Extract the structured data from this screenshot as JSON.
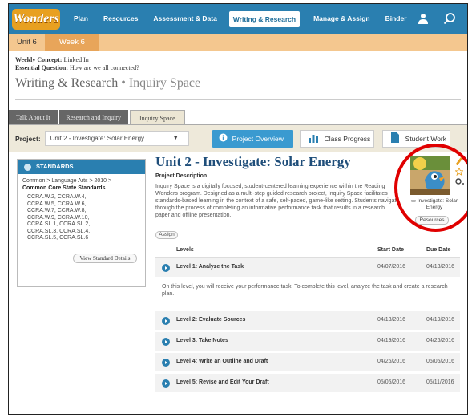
{
  "app": {
    "logo": "Wonders"
  },
  "nav": {
    "items": [
      "Plan",
      "Resources",
      "Assessment & Data",
      "Writing & Research",
      "Manage & Assign",
      "Binder"
    ],
    "active": "Writing & Research"
  },
  "unitbar": {
    "unit": "Unit 6",
    "week": "Week 6"
  },
  "concept": {
    "weekly_label": "Weekly Concept:",
    "weekly_value": "Linked In",
    "question_label": "Essential Question:",
    "question_value": "How are we all connected?"
  },
  "section": {
    "title": "Writing & Research",
    "separator": "•",
    "subtitle": "Inquiry Space"
  },
  "tabs": [
    "Talk About It",
    "Research and Inquiry",
    "Inquiry Space"
  ],
  "project": {
    "label": "Project:",
    "selected": "Unit 2 - Investigate: Solar Energy",
    "overview_button": "Project Overview",
    "progress_button": "Class Progress",
    "work_button": "Student Work"
  },
  "standards": {
    "header": "STANDARDS",
    "path": "Common > Language Arts > 2010 >",
    "set": "Common Core State Standards",
    "codes": [
      "CCRA.W.2, CCRA.W.4,",
      "CCRA.W.5, CCRA.W.6,",
      "CCRA.W.7, CCRA.W.8,",
      "CCRA.W.9, CCRA.W.10,",
      "CCRA.SL.1, CCRA.SL.2,",
      "CCRA.SL.3, CCRA.SL.4,",
      "CCRA.SL.5, CCRA.SL.6"
    ],
    "view_button": "View Standard Details"
  },
  "unit": {
    "title": "Unit 2 - Investigate: Solar Energy",
    "desc_label": "Project Description",
    "description": "Inquiry Space is a digitally focused, student-centered learning experience within the Reading Wonders program. Designed as a multi-step guided research project, Inquiry Space facilitates standards-based learning in the context of a safe, self-paced, game-like setting. Students navigate through the process of completing an informative performance task that results in a research paper and offline presentation.",
    "assign_button": "Assign",
    "thumb_caption": "Investigate: Solar Energy",
    "resources_button": "Resources"
  },
  "levels": {
    "headers": {
      "levels": "Levels",
      "start": "Start Date",
      "due": "Due Date"
    },
    "rows": [
      {
        "name": "Level 1: Analyze the Task",
        "start": "04/07/2016",
        "due": "04/13/2016"
      },
      {
        "name": "Level 2: Evaluate Sources",
        "start": "04/13/2016",
        "due": "04/19/2016"
      },
      {
        "name": "Level 3: Take Notes",
        "start": "04/19/2016",
        "due": "04/26/2016"
      },
      {
        "name": "Level 4: Write an Outline and Draft",
        "start": "04/26/2016",
        "due": "05/05/2016"
      },
      {
        "name": "Level 5: Revise and Edit Your Draft",
        "start": "05/05/2016",
        "due": "05/11/2016"
      }
    ],
    "detail": "On this level, you will receive your performance task. To complete this level, analyze the task and create a research plan."
  },
  "colors": {
    "nav": "#2a7fb0",
    "accent": "#e8a55a",
    "highlight_ring": "#e00000",
    "title": "#1f4e7a"
  },
  "icons": [
    "user-icon",
    "search-icon",
    "info-icon",
    "bar-chart-icon",
    "document-icon",
    "pencil-icon",
    "star-icon",
    "gear-icon",
    "play-icon"
  ]
}
